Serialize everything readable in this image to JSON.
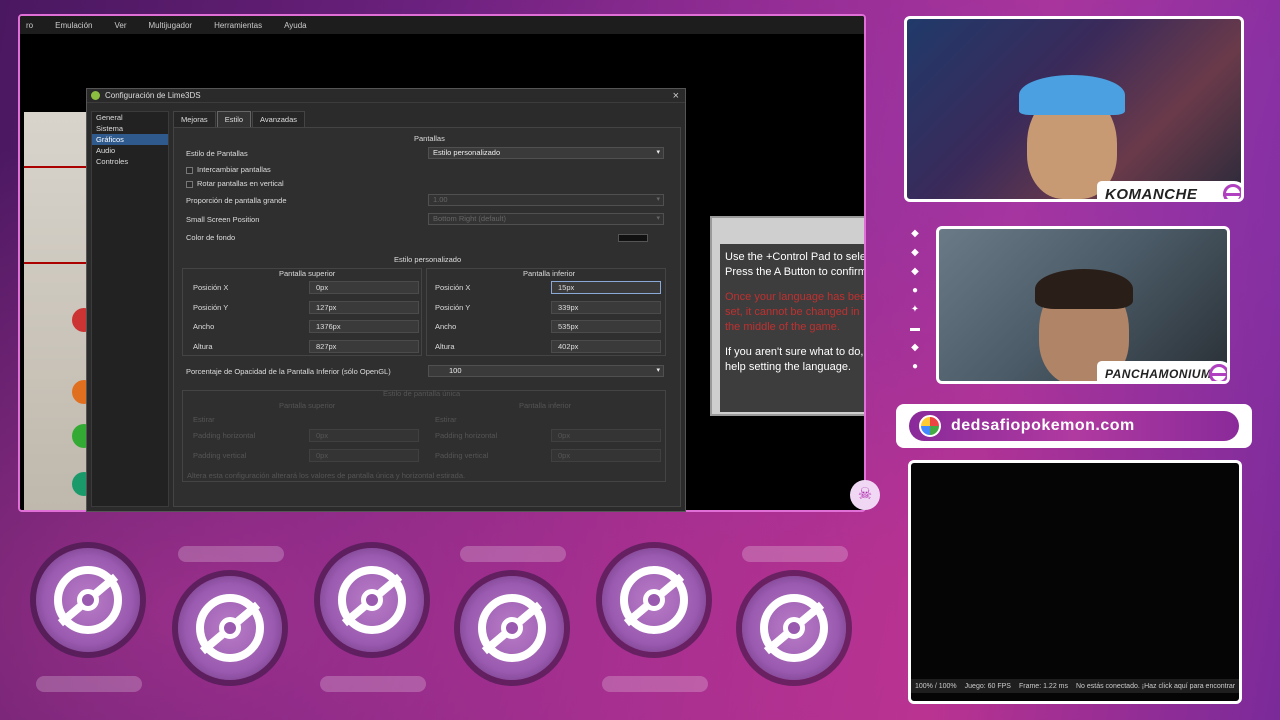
{
  "emulator": {
    "menu": [
      "ro",
      "Emulación",
      "Ver",
      "Multijugador",
      "Herramientas",
      "Ayuda"
    ]
  },
  "dialog": {
    "title": "Configuración de Lime3DS",
    "close": "×",
    "sidebar": [
      "General",
      "Sistema",
      "Gráficos",
      "Audio",
      "Controles"
    ],
    "tabs": [
      "Mejoras",
      "Estilo",
      "Avanzadas"
    ],
    "screens_header": "Pantallas",
    "layout_label": "Estilo de Pantallas",
    "layout_value": "Estilo personalizado",
    "swap_label": "Intercambiar pantallas",
    "rotate_label": "Rotar pantallas en vertical",
    "large_ratio_label": "Proporción de pantalla grande",
    "large_ratio_value": "1.00",
    "small_pos_label": "Small Screen Position",
    "small_pos_value": "Bottom Right (default)",
    "bg_color_label": "Color de fondo",
    "custom_header": "Estilo personalizado",
    "top_screen": {
      "title": "Pantalla superior",
      "rows": [
        {
          "label": "Posición X",
          "value": "0px"
        },
        {
          "label": "Posición Y",
          "value": "127px"
        },
        {
          "label": "Ancho",
          "value": "1376px"
        },
        {
          "label": "Altura",
          "value": "827px"
        }
      ]
    },
    "bottom_screen": {
      "title": "Pantalla inferior",
      "rows": [
        {
          "label": "Posición X",
          "value": "15px"
        },
        {
          "label": "Posición Y",
          "value": "339px"
        },
        {
          "label": "Ancho",
          "value": "535px"
        },
        {
          "label": "Altura",
          "value": "402px"
        }
      ]
    },
    "opacity_label": "Porcentaje de Opacidad de la Pantalla Inferior (sólo OpenGL)",
    "opacity_value": "100",
    "dim_header": "Estilo de pantalla única",
    "dim_top": "Pantalla superior",
    "dim_bottom": "Pantalla inferior",
    "dim_stretch": "Estirar",
    "dim_pad_h": "Padding horizontal",
    "dim_pad_v": "Padding vertical",
    "dim_val": "0px",
    "dim_note": "Altera esta configuración alterará los valores de pantalla única y horizontal estirada."
  },
  "game": {
    "line1": "Use the +Control Pad to select",
    "line2": "Press the A Button to confirm.",
    "red": "Once your language has been set, it cannot be changed in the middle of the game.",
    "line3": "If you aren't sure what to do,",
    "line4": "help setting the language."
  },
  "streamers": {
    "top": "KOMANCHE",
    "bottom": "PANCHAMONIUM"
  },
  "website": "dedsafiopokemon.com",
  "status": {
    "speed": "100% / 100%",
    "fps": "Juego: 60 FPS",
    "frame": "Frame: 1.22 ms",
    "net": "No estás conectado. ¡Haz click aquí para encontrar"
  },
  "colors": {
    "accent": "#b040c0",
    "selection": "#2e5a8e"
  }
}
